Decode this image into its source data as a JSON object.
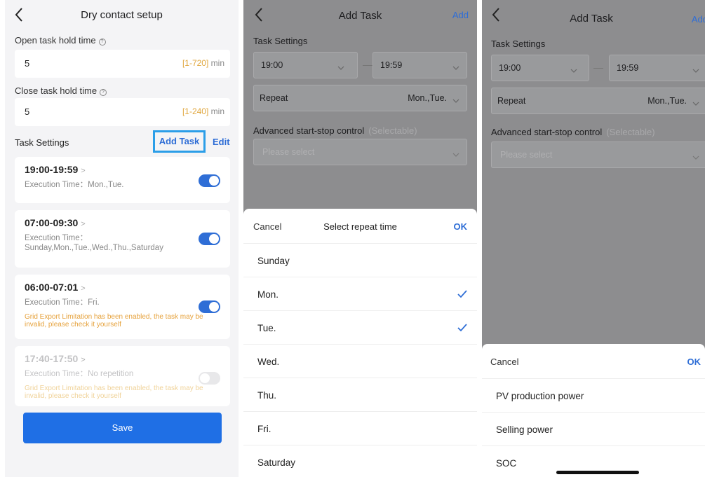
{
  "panel1": {
    "title": "Dry contact setup",
    "open_hold": {
      "label": "Open task hold time",
      "value": "5",
      "range": "[1-720]",
      "unit": "min"
    },
    "close_hold": {
      "label": "Close task hold time",
      "value": "5",
      "range": "[1-240]",
      "unit": "min"
    },
    "task_settings_label": "Task Settings",
    "add_task_label": "Add Task",
    "edit_label": "Edit",
    "tasks": [
      {
        "time": "19:00-19:59",
        "exec": "Execution Time：Mon.,Tue.",
        "warning": "",
        "enabled": true
      },
      {
        "time": "07:00-09:30",
        "exec": "Execution Time：Sunday,Mon.,Tue.,Wed.,Thu.,Saturday",
        "warning": "",
        "enabled": true
      },
      {
        "time": "06:00-07:01",
        "exec": "Execution Time：Fri.",
        "warning": "Grid Export Limitation has been enabled, the task may be invalid, please check it yourself",
        "enabled": true
      },
      {
        "time": "17:40-17:50",
        "exec": "Execution Time：No repetition",
        "warning": "Grid Export Limitation has been enabled, the task may be invalid, please check it yourself",
        "enabled": false
      }
    ],
    "save_label": "Save"
  },
  "panel2": {
    "title": "Add Task",
    "add_label": "Add",
    "task_settings_label": "Task Settings",
    "start_time": "19:00",
    "end_time": "19:59",
    "repeat_label": "Repeat",
    "repeat_value": "Mon.,Tue.",
    "advanced_label": "Advanced start-stop control",
    "advanced_hint": "(Selectable)",
    "advanced_placeholder": "Please select",
    "sheet": {
      "cancel": "Cancel",
      "title": "Select repeat time",
      "ok": "OK",
      "options": [
        {
          "label": "Sunday",
          "checked": false
        },
        {
          "label": "Mon.",
          "checked": true
        },
        {
          "label": "Tue.",
          "checked": true
        },
        {
          "label": "Wed.",
          "checked": false
        },
        {
          "label": "Thu.",
          "checked": false
        },
        {
          "label": "Fri.",
          "checked": false
        },
        {
          "label": "Saturday",
          "checked": false
        }
      ]
    }
  },
  "panel3": {
    "title": "Add Task",
    "add_label": "Add",
    "task_settings_label": "Task Settings",
    "start_time": "19:00",
    "end_time": "19:59",
    "repeat_label": "Repeat",
    "repeat_value": "Mon.,Tue.",
    "advanced_label": "Advanced start-stop control",
    "advanced_hint": "(Selectable)",
    "advanced_placeholder": "Please select",
    "sheet": {
      "cancel": "Cancel",
      "ok": "OK",
      "options": [
        {
          "label": "PV production power"
        },
        {
          "label": "Selling power"
        },
        {
          "label": "SOC"
        }
      ]
    }
  },
  "colors": {
    "accent": "#2f6ed6",
    "warning": "#e6a23c",
    "highlight_border": "#2b9ee8"
  }
}
